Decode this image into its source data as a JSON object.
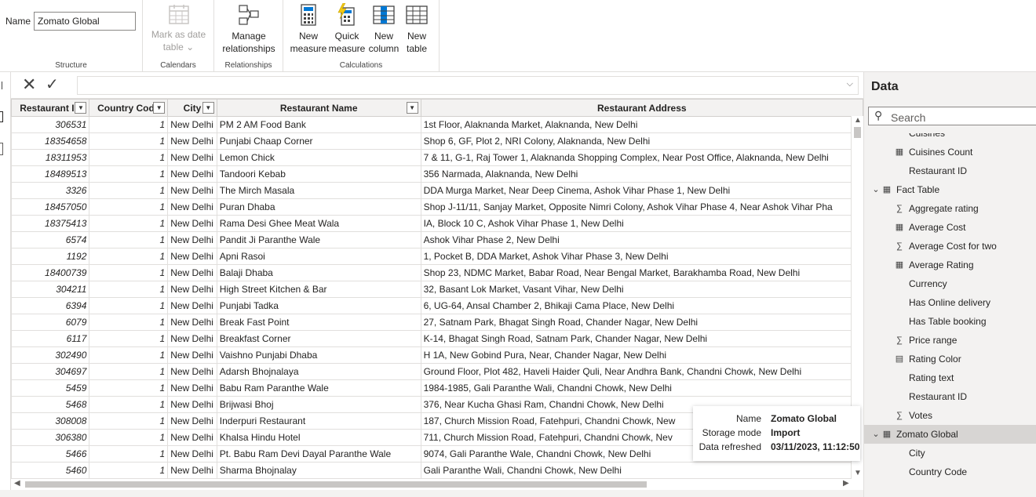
{
  "ribbon": {
    "name_label": "Name",
    "name_value": "Zomato Global",
    "structure_label": "Structure",
    "calendars": {
      "button_label_1": "Mark as date",
      "button_label_2": "table ⌄",
      "group_label": "Calendars"
    },
    "relationships": {
      "button_label_1": "Manage",
      "button_label_2": "relationships",
      "group_label": "Relationships"
    },
    "calculations": {
      "group_label": "Calculations",
      "buttons": [
        {
          "line1": "New",
          "line2": "measure"
        },
        {
          "line1": "Quick",
          "line2": "measure"
        },
        {
          "line1": "New",
          "line2": "column"
        },
        {
          "line1": "New",
          "line2": "table"
        }
      ]
    }
  },
  "table": {
    "headers": [
      "Restaurant ID",
      "Country Code",
      "City",
      "Restaurant Name",
      "Restaurant Address"
    ],
    "rows": [
      [
        "306531",
        "1",
        "New Delhi",
        "PM 2 AM Food Bank",
        "1st Floor, Alaknanda Market, Alaknanda, New Delhi"
      ],
      [
        "18354658",
        "1",
        "New Delhi",
        "Punjabi Chaap Corner",
        "Shop 6, GF, Plot 2, NRI Colony, Alaknanda, New Delhi"
      ],
      [
        "18311953",
        "1",
        "New Delhi",
        "Lemon Chick",
        "7 & 11, G-1, Raj Tower 1, Alaknanda Shopping Complex, Near Post Office, Alaknanda, New Delhi"
      ],
      [
        "18489513",
        "1",
        "New Delhi",
        "Tandoori Kebab",
        "356 Narmada, Alaknanda, New Delhi"
      ],
      [
        "3326",
        "1",
        "New Delhi",
        "The Mirch Masala",
        "DDA Murga Market, Near Deep Cinema, Ashok Vihar Phase 1, New Delhi"
      ],
      [
        "18457050",
        "1",
        "New Delhi",
        "Puran Dhaba",
        "Shop J-11/11, Sanjay Market, Opposite Nimri Colony, Ashok Vihar Phase 4, Near Ashok Vihar Pha"
      ],
      [
        "18375413",
        "1",
        "New Delhi",
        "Rama Desi Ghee Meat Wala",
        "IA, Block 10 C, Ashok Vihar Phase 1, New Delhi"
      ],
      [
        "6574",
        "1",
        "New Delhi",
        "Pandit Ji Paranthe Wale",
        "Ashok Vihar Phase 2, New Delhi"
      ],
      [
        "1192",
        "1",
        "New Delhi",
        "Apni Rasoi",
        "1, Pocket B, DDA Market, Ashok Vihar Phase 3, New Delhi"
      ],
      [
        "18400739",
        "1",
        "New Delhi",
        "Balaji Dhaba",
        "Shop 23, NDMC Market, Babar Road, Near Bengal Market, Barakhamba Road, New Delhi"
      ],
      [
        "304211",
        "1",
        "New Delhi",
        "High Street Kitchen & Bar",
        "32, Basant Lok Market, Vasant Vihar, New Delhi"
      ],
      [
        "6394",
        "1",
        "New Delhi",
        "Punjabi Tadka",
        "6, UG-64, Ansal Chamber 2, Bhikaji Cama Place, New Delhi"
      ],
      [
        "6079",
        "1",
        "New Delhi",
        "Break Fast Point",
        "27, Satnam Park, Bhagat Singh Road, Chander Nagar, New Delhi"
      ],
      [
        "6117",
        "1",
        "New Delhi",
        "Breakfast Corner",
        "K-14, Bhagat Singh Road, Satnam Park, Chander Nagar, New Delhi"
      ],
      [
        "302490",
        "1",
        "New Delhi",
        "Vaishno Punjabi Dhaba",
        "H 1A, New Gobind Pura, Near, Chander Nagar, New Delhi"
      ],
      [
        "304697",
        "1",
        "New Delhi",
        "Adarsh Bhojnalaya",
        "Ground Floor, Plot 482, Haveli Haider Quli, Near Andhra Bank, Chandni Chowk, New Delhi"
      ],
      [
        "5459",
        "1",
        "New Delhi",
        "Babu Ram Paranthe Wale",
        "1984-1985, Gali Paranthe Wali, Chandni Chowk, New Delhi"
      ],
      [
        "5468",
        "1",
        "New Delhi",
        "Brijwasi Bhoj",
        "376, Near Kucha Ghasi Ram, Chandni Chowk, New Delhi"
      ],
      [
        "308008",
        "1",
        "New Delhi",
        "Inderpuri Restaurant",
        "187, Church Mission Road, Fatehpuri, Chandni Chowk, New"
      ],
      [
        "306380",
        "1",
        "New Delhi",
        "Khalsa Hindu Hotel",
        "711, Church Mission Road, Fatehpuri, Chandni Chowk, Nev"
      ],
      [
        "5466",
        "1",
        "New Delhi",
        "Pt. Babu Ram Devi Dayal Paranthe Wale",
        "9074, Gali Paranthe Wale, Chandni Chowk, New Delhi"
      ],
      [
        "5460",
        "1",
        "New Delhi",
        "Sharma Bhojnalay",
        "Gali Paranthe Wali, Chandni Chowk, New Delhi"
      ]
    ]
  },
  "tooltip": {
    "rows": [
      {
        "key": "Name",
        "value": "Zomato Global"
      },
      {
        "key": "Storage mode",
        "value": "Import"
      },
      {
        "key": "Data refreshed",
        "value": "03/11/2023, 11:12:50"
      }
    ]
  },
  "data_pane": {
    "title": "Data",
    "search_placeholder": "Search",
    "fields": [
      {
        "label": "Cuisines",
        "icon": "",
        "level": 2
      },
      {
        "label": "Cuisines Count",
        "icon": "calculator-icon",
        "level": 2
      },
      {
        "label": "Restaurant ID",
        "icon": "",
        "level": 2
      },
      {
        "label": "Fact Table",
        "icon": "table-icon",
        "level": 1,
        "expand": "chevron-down-icon"
      },
      {
        "label": "Aggregate rating",
        "icon": "sigma-icon",
        "level": 2
      },
      {
        "label": "Average Cost",
        "icon": "calculator-icon",
        "level": 2
      },
      {
        "label": "Average Cost for two",
        "icon": "sigma-icon",
        "level": 2
      },
      {
        "label": "Average Rating",
        "icon": "calculator-icon",
        "level": 2
      },
      {
        "label": "Currency",
        "icon": "",
        "level": 2
      },
      {
        "label": "Has Online delivery",
        "icon": "",
        "level": 2
      },
      {
        "label": "Has Table booking",
        "icon": "",
        "level": 2
      },
      {
        "label": "Price range",
        "icon": "sigma-icon",
        "level": 2
      },
      {
        "label": "Rating Color",
        "icon": "calculated-column-icon",
        "level": 2
      },
      {
        "label": "Rating text",
        "icon": "",
        "level": 2
      },
      {
        "label": "Restaurant ID",
        "icon": "",
        "level": 2
      },
      {
        "label": "Votes",
        "icon": "sigma-icon",
        "level": 2
      },
      {
        "label": "Zomato Global",
        "icon": "table-icon",
        "level": 1,
        "expand": "chevron-down-icon",
        "selected": true
      },
      {
        "label": "City",
        "icon": "",
        "level": 2
      },
      {
        "label": "Country Code",
        "icon": "",
        "level": 2
      }
    ]
  },
  "colors": {
    "accent": "#0078d4",
    "selected_row": "#d7d5d3",
    "header_bg": "#f3f2f1",
    "quick_measure_icon": "#f2c811"
  }
}
